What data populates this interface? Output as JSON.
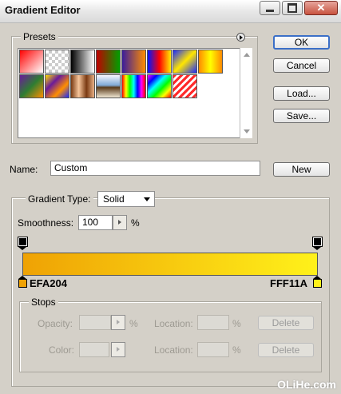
{
  "window": {
    "title": "Gradient Editor",
    "close_glyph": "✕"
  },
  "presets": {
    "legend": "Presets",
    "swatches": [
      {
        "name": "foreground-to-background",
        "bg": "linear-gradient(135deg,#ff0000,#ffffff)"
      },
      {
        "name": "foreground-to-transparent",
        "bg": "repeating-conic-gradient(#ccc 0 25%,#fff 0 50%) 0 0/8px 8px"
      },
      {
        "name": "black-white",
        "bg": "linear-gradient(to right,#000,#fff)"
      },
      {
        "name": "red-green",
        "bg": "linear-gradient(to right,#c00000,#00a000)"
      },
      {
        "name": "violet-orange",
        "bg": "linear-gradient(to right,#3a1c9c,#ff8c00)"
      },
      {
        "name": "blue-red-yellow",
        "bg": "linear-gradient(to right,#0015ff,#ff0000,#ffee00)"
      },
      {
        "name": "blue-yellow-blue",
        "bg": "linear-gradient(135deg,#1a2aff,#ffe600,#1a2aff)"
      },
      {
        "name": "orange-yellow-orange",
        "bg": "linear-gradient(to right,#ff8a00,#ffff00,#ff8a00)"
      },
      {
        "name": "violet-green-orange",
        "bg": "linear-gradient(135deg,#6a1b9a,#2e7d32,#ff8f00)"
      },
      {
        "name": "yellow-violet-orange-blue",
        "bg": "linear-gradient(135deg,#ffe100,#6a1b9a,#ff8f00,#1a2aff)"
      },
      {
        "name": "copper",
        "bg": "linear-gradient(to right,#7a3a12,#f6c59b,#7a3a12,#e9b186)"
      },
      {
        "name": "chrome",
        "bg": "linear-gradient(to bottom,#f8f8ff 0%,#7fa9d6 45%,#5a3a1a 55%,#f0e7d3 100%)"
      },
      {
        "name": "spectrum",
        "bg": "linear-gradient(to right,#ff0000,#ffff00,#00ff00,#00ffff,#0000ff,#ff00ff,#ff0000)"
      },
      {
        "name": "transparent-rainbow",
        "bg": "linear-gradient(135deg,#ff00ff,#0000ff,#00ffff,#00ff00,#ffff00,#ff0000)"
      },
      {
        "name": "transparent-stripes",
        "bg": "repeating-linear-gradient(135deg,#ff2a2a 0 3px,#ffffff 3px 6px)"
      }
    ]
  },
  "buttons": {
    "ok": "OK",
    "cancel": "Cancel",
    "load": "Load...",
    "save": "Save...",
    "new": "New"
  },
  "name_field": {
    "label": "Name:",
    "value": "Custom"
  },
  "gradient_type": {
    "label": "Gradient Type:",
    "value": "Solid"
  },
  "smoothness": {
    "label": "Smoothness:",
    "value": "100",
    "unit": "%"
  },
  "gradient": {
    "start_color": "#EFA204",
    "end_color": "#FFF11A",
    "start_label": "EFA204",
    "end_label": "FFF11A"
  },
  "stops": {
    "legend": "Stops",
    "opacity_label": "Opacity:",
    "opacity_unit": "%",
    "location_label": "Location:",
    "location_unit": "%",
    "delete_label": "Delete",
    "color_label": "Color:",
    "color_location_label": "Location:",
    "color_location_unit": "%",
    "color_delete_label": "Delete"
  },
  "watermark": "OLiHe.com"
}
